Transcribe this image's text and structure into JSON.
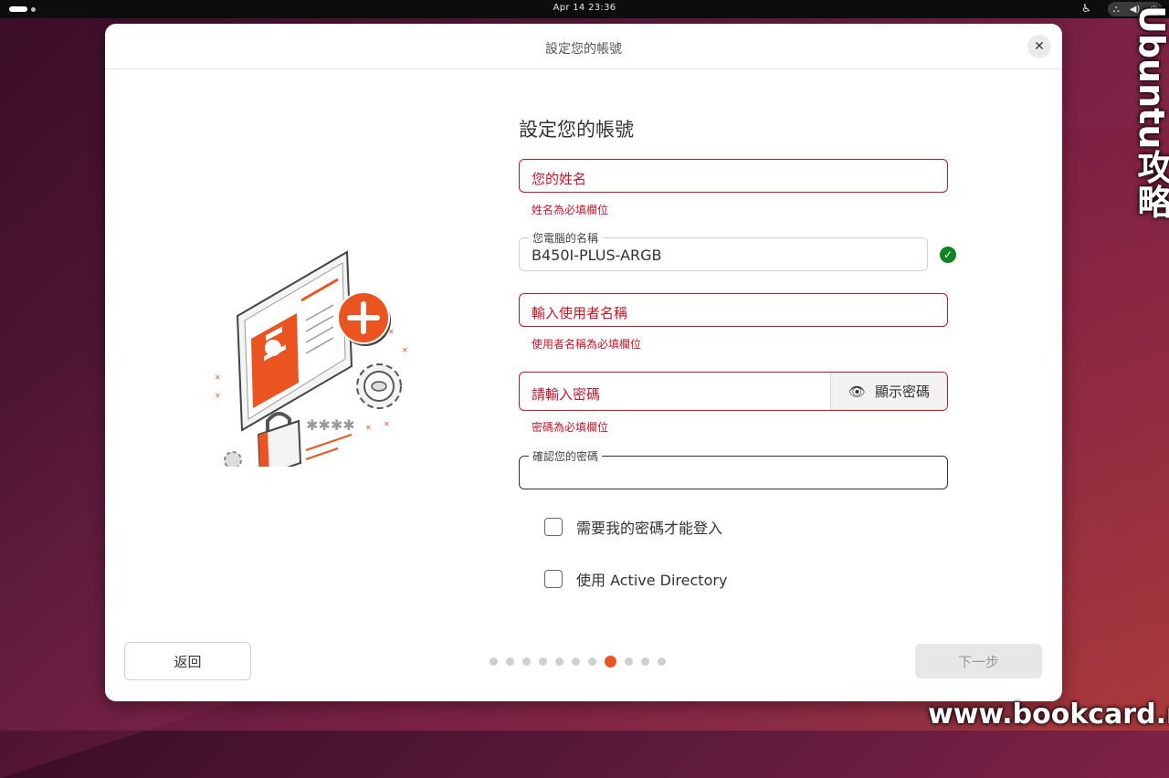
{
  "topbar": {
    "clock": "Apr 14  23:36"
  },
  "dialog": {
    "title": "設定您的帳號",
    "form_title": "設定您的帳號",
    "name": {
      "placeholder": "您的姓名",
      "error": "姓名為必填欄位"
    },
    "computer": {
      "label": "您電腦的名稱",
      "value": "B450I-PLUS-ARGB"
    },
    "username": {
      "placeholder": "輸入使用者名稱",
      "error": "使用者名稱為必填欄位"
    },
    "password": {
      "placeholder": "請輸入密碼",
      "show_label": "顯示密碼",
      "error": "密碼為必填欄位"
    },
    "confirm": {
      "label": "確認您的密碼"
    },
    "options": {
      "require_password": "需要我的密碼才能登入",
      "active_directory": "使用 Active Directory"
    },
    "back_label": "返回",
    "next_label": "下一步",
    "progress": {
      "total": 11,
      "current": 8
    }
  },
  "watermark": {
    "side": "Ubuntu攻略",
    "bottom": "www.bookcard.net"
  },
  "colors": {
    "accent": "#e95420",
    "error": "#c7162b",
    "ok": "#0e8420"
  }
}
